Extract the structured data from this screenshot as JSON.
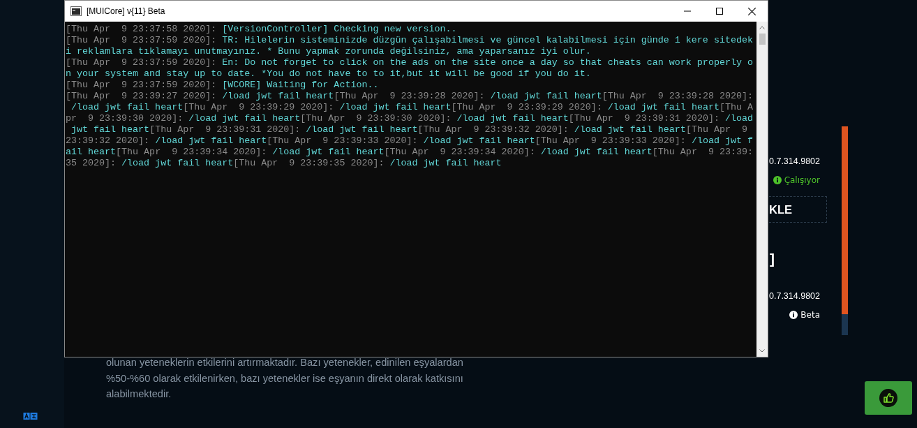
{
  "page": {
    "info_panel": {
      "items": [
        {
          "kind": "version",
          "text": "0.7.314.9802"
        },
        {
          "kind": "status",
          "text": "Çalışıyor",
          "color": "#4ec32a"
        },
        {
          "kind": "button",
          "text": "KLE"
        },
        {
          "kind": "heading",
          "text": "]"
        },
        {
          "kind": "version",
          "text": "0.7.314.9802"
        },
        {
          "kind": "status",
          "text": "Beta",
          "color": "#ffffff"
        }
      ]
    },
    "progress_bar": {
      "level": 0.9
    },
    "description": {
      "lines": [
        "olunan yeteneklerin etkilerini artırmaktadır. Bazı yetenekler, edinilen eşyalardan",
        "%50-%60 olarak etkilenirken, bazı yetenekler ise eşyanın direkt olarak katkısını",
        "alabilmektedir."
      ]
    }
  },
  "window": {
    "title": "[MUICore] v{11} Beta",
    "console": {
      "lines": [
        [
          {
            "kind": "time",
            "text": "[Thu Apr  9 23:37:58 2020]: "
          },
          {
            "kind": "msg",
            "text": "[VersionController] Checking new version.."
          }
        ],
        [
          {
            "kind": "time",
            "text": "[Thu Apr  9 23:37:59 2020]: "
          },
          {
            "kind": "msg",
            "text": "TR: Hilelerin sisteminizde düzgün çalışabilmesi ve güncel kalabilmesi için günde 1 kere sitedek"
          }
        ],
        [
          {
            "kind": "msg",
            "text": "i reklamlara tıklamayı unutmayınız. * Bunu yapmak zorunda değilsiniz, ama yaparsanız iyi olur."
          }
        ],
        [
          {
            "kind": "time",
            "text": "[Thu Apr  9 23:37:59 2020]: "
          },
          {
            "kind": "msg",
            "text": "En: Do not forget to click on the ads on the site once a day so that cheats can work properly o"
          }
        ],
        [
          {
            "kind": "msg",
            "text": "n your system and stay up to date. *You do not have to to it,but it will be good if you do it."
          }
        ],
        [
          {
            "kind": "time",
            "text": "[Thu Apr  9 23:37:59 2020]: "
          },
          {
            "kind": "msg",
            "text": "[WCORE] Waiting for Action.."
          }
        ],
        [
          {
            "kind": "time",
            "text": "[Thu Apr  9 23:39:27 2020]: "
          },
          {
            "kind": "msg",
            "text": "/load jwt fail heart"
          },
          {
            "kind": "time",
            "text": "[Thu Apr  9 23:39:28 2020]: "
          },
          {
            "kind": "msg",
            "text": "/load jwt fail heart"
          },
          {
            "kind": "time",
            "text": "[Thu Apr  9 23:39:28 2020]:"
          }
        ],
        [
          {
            "kind": "msg",
            "text": " /load jwt fail heart"
          },
          {
            "kind": "time",
            "text": "[Thu Apr  9 23:39:29 2020]: "
          },
          {
            "kind": "msg",
            "text": "/load jwt fail heart"
          },
          {
            "kind": "time",
            "text": "[Thu Apr  9 23:39:29 2020]: "
          },
          {
            "kind": "msg",
            "text": "/load jwt fail heart"
          },
          {
            "kind": "time",
            "text": "[Thu A"
          }
        ],
        [
          {
            "kind": "time",
            "text": "pr  9 23:39:30 2020]: "
          },
          {
            "kind": "msg",
            "text": "/load jwt fail heart"
          },
          {
            "kind": "time",
            "text": "[Thu Apr  9 23:39:30 2020]: "
          },
          {
            "kind": "msg",
            "text": "/load jwt fail heart"
          },
          {
            "kind": "time",
            "text": "[Thu Apr  9 23:39:31 2020]: "
          },
          {
            "kind": "msg",
            "text": "/load"
          }
        ],
        [
          {
            "kind": "msg",
            "text": " jwt fail heart"
          },
          {
            "kind": "time",
            "text": "[Thu Apr  9 23:39:31 2020]: "
          },
          {
            "kind": "msg",
            "text": "/load jwt fail heart"
          },
          {
            "kind": "time",
            "text": "[Thu Apr  9 23:39:32 2020]: "
          },
          {
            "kind": "msg",
            "text": "/load jwt fail heart"
          },
          {
            "kind": "time",
            "text": "[Thu Apr  9"
          }
        ],
        [
          {
            "kind": "time",
            "text": "23:39:32 2020]: "
          },
          {
            "kind": "msg",
            "text": "/load jwt fail heart"
          },
          {
            "kind": "time",
            "text": "[Thu Apr  9 23:39:33 2020]: "
          },
          {
            "kind": "msg",
            "text": "/load jwt fail heart"
          },
          {
            "kind": "time",
            "text": "[Thu Apr  9 23:39:33 2020]: "
          },
          {
            "kind": "msg",
            "text": "/load jwt f"
          }
        ],
        [
          {
            "kind": "msg",
            "text": "ail heart"
          },
          {
            "kind": "time",
            "text": "[Thu Apr  9 23:39:34 2020]: "
          },
          {
            "kind": "msg",
            "text": "/load jwt fail heart"
          },
          {
            "kind": "time",
            "text": "[Thu Apr  9 23:39:34 2020]: "
          },
          {
            "kind": "msg",
            "text": "/load jwt fail heart"
          },
          {
            "kind": "time",
            "text": "[Thu Apr  9 23:39:"
          }
        ],
        [
          {
            "kind": "time",
            "text": "35 2020]: "
          },
          {
            "kind": "msg",
            "text": "/load jwt fail heart"
          },
          {
            "kind": "time",
            "text": "[Thu Apr  9 23:39:35 2020]: "
          },
          {
            "kind": "msg",
            "text": "/load jwt fail heart"
          }
        ]
      ]
    }
  }
}
